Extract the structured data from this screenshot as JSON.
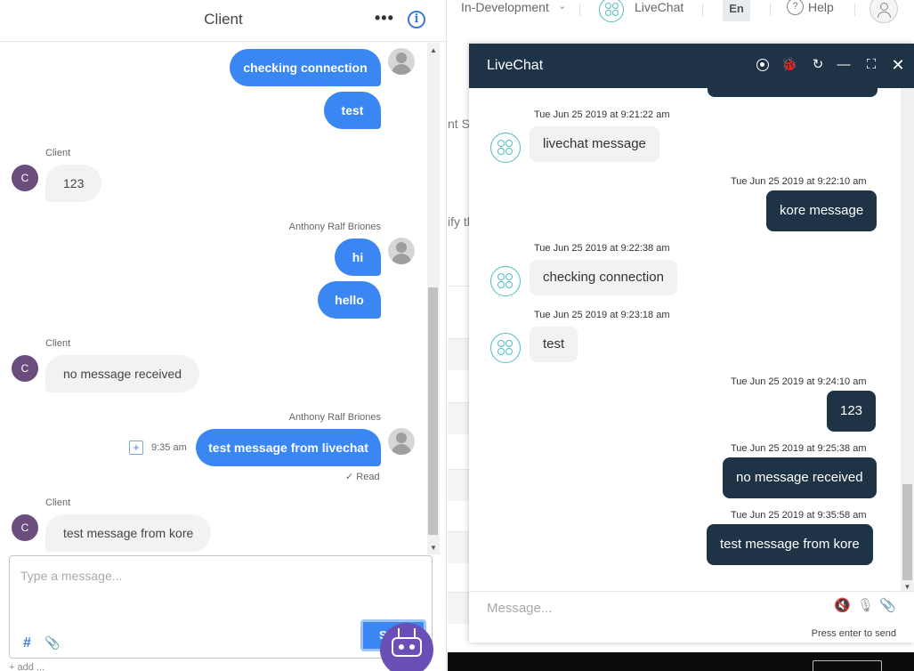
{
  "left_panel": {
    "title": "Client",
    "more_icon": "more-horizontal-icon",
    "info_icon": "info-icon",
    "info_glyph": "i",
    "messages": [
      {
        "type": "out",
        "text": "checking connection"
      },
      {
        "type": "out",
        "text": "test"
      },
      {
        "type": "in",
        "sender": "Client",
        "avatar": "C",
        "text": "123"
      },
      {
        "type": "out",
        "sender": "Anthony Ralf Briones",
        "text": "hi"
      },
      {
        "type": "out",
        "text": "hello"
      },
      {
        "type": "in",
        "sender": "Client",
        "avatar": "C",
        "text": "no message received"
      },
      {
        "type": "out",
        "sender": "Anthony Ralf Briones",
        "time": "9:35 am",
        "status": "✓ Read",
        "text": "test message from livechat"
      },
      {
        "type": "in",
        "sender": "Client",
        "avatar": "C",
        "text": "test message from kore"
      }
    ],
    "composer": {
      "placeholder": "Type a message...",
      "hash_glyph": "#",
      "clip_glyph": "📎",
      "send_label": "Send",
      "send_visible": "S"
    },
    "bottom_text": "+ add ..."
  },
  "background_app": {
    "env_label": "In-Development",
    "bot_name": "LiveChat",
    "language": "En",
    "help_label": "Help",
    "help_glyph": "?",
    "frag_1": "nt Se",
    "frag_2": "ify th"
  },
  "livechat": {
    "title": "LiveChat",
    "header_icons": [
      "record-icon",
      "bug-icon",
      "refresh-icon",
      "minimize-icon",
      "expand-icon",
      "close-icon"
    ],
    "icon_glyphs": {
      "bug": "🐞",
      "refresh": "↻",
      "minimize": "—",
      "expand": "⛶",
      "close": "✕"
    },
    "messages": [
      {
        "type": "in",
        "timestamp": "Tue Jun 25 2019 at 9:21:22 am",
        "text": "livechat message"
      },
      {
        "type": "out",
        "timestamp": "Tue Jun 25 2019 at 9:22:10 am",
        "text": "kore message"
      },
      {
        "type": "in",
        "timestamp": "Tue Jun 25 2019 at 9:22:38 am",
        "text": "checking connection"
      },
      {
        "type": "in",
        "timestamp": "Tue Jun 25 2019 at 9:23:18 am",
        "text": "test"
      },
      {
        "type": "out",
        "timestamp": "Tue Jun 25 2019 at 9:24:10 am",
        "text": "123"
      },
      {
        "type": "out",
        "timestamp": "Tue Jun 25 2019 at 9:25:38 am",
        "text": "no message received"
      },
      {
        "type": "out",
        "timestamp": "Tue Jun 25 2019 at 9:35:58 am",
        "text": "test message from kore"
      }
    ],
    "input_placeholder": "Message...",
    "footer_icons": [
      "speaker-mute-icon",
      "microphone-icon",
      "attachment-icon"
    ],
    "footer_glyphs": {
      "speaker": "🔇",
      "mic": "🎙",
      "attach": "📎"
    },
    "hint": "Press enter to send"
  },
  "colors": {
    "agent_bubble": "#3a86f2",
    "client_avatar": "#6a4c7d",
    "widget_header": "#1f3347",
    "bot_avatar_outline": "#4dbdc2"
  }
}
